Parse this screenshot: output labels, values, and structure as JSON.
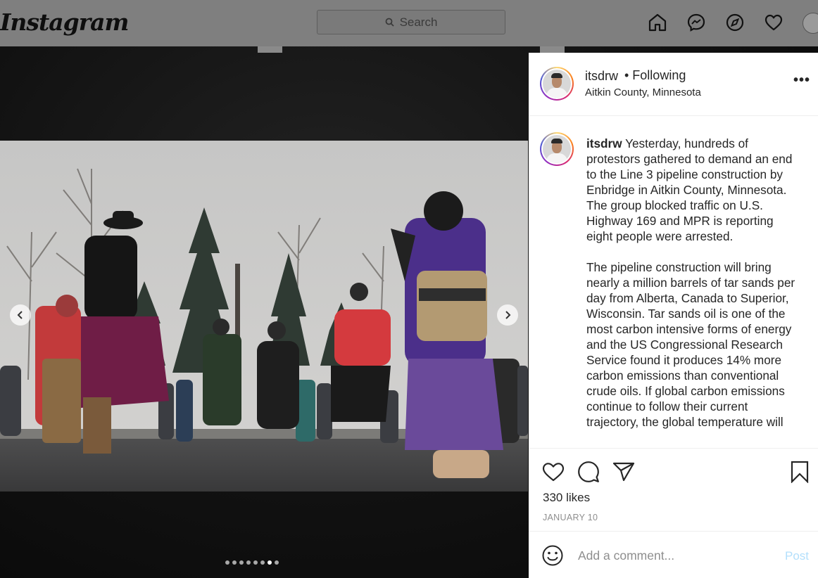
{
  "nav": {
    "logo": "Instagram",
    "search_placeholder": "Search",
    "icons": [
      "home-icon",
      "messenger-icon",
      "explore-icon",
      "heart-icon",
      "profile-avatar"
    ]
  },
  "post": {
    "username": "itsdrw",
    "follow_status": "• Following",
    "location": "Aitkin County, Minnesota",
    "more_label": "•••",
    "caption_paragraphs": [
      "Yesterday, hundreds of protestors gathered to demand an end to the Line 3 pipeline construction by Enbridge in Aitkin County, Minnesota. The group blocked traffic on U.S. Highway 169 and MPR is reporting eight people were arrested.",
      "The pipeline construction will bring nearly a million barrels of tar sands per day from Alberta, Canada to Superior, Wisconsin. Tar sands oil is one of the most carbon intensive forms of energy and the US Congressional Research Service found it produces 14% more carbon emissions than conventional crude oils. If global carbon emissions continue to follow their current trajectory, the global temperature will"
    ],
    "likes": "330 likes",
    "date": "JANUARY 10",
    "comment_placeholder": "Add a comment...",
    "post_label": "Post",
    "carousel": {
      "total": 8,
      "active": 7
    }
  },
  "colors": {
    "text": "#262626",
    "muted": "#8e8e8e",
    "post_disabled": "#b2dffc"
  }
}
